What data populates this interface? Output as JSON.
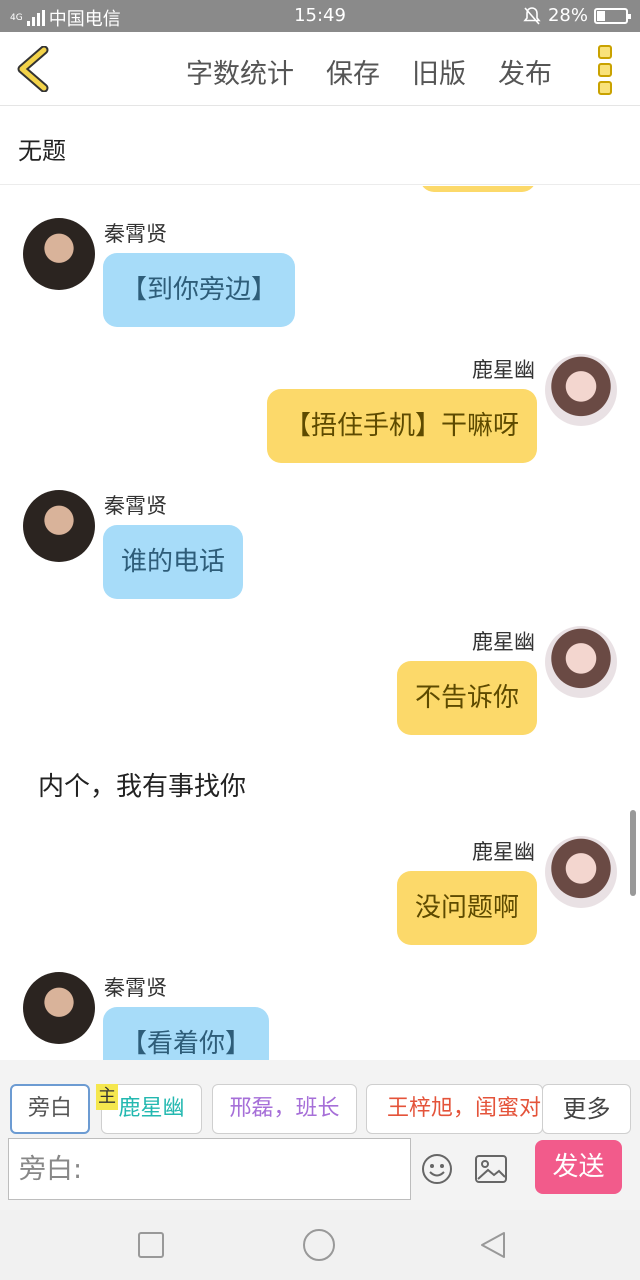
{
  "status": {
    "carrier": "中国电信",
    "network": "4G",
    "time": "15:49",
    "battery": "28%",
    "battery_level": 0.28
  },
  "toolbar": {
    "word_count": "字数统计",
    "save": "保存",
    "old_version": "旧版",
    "publish": "发布"
  },
  "story": {
    "title": "无题"
  },
  "messages": [
    {
      "name": "秦霄贤",
      "text": "【到你旁边】"
    },
    {
      "name": "鹿星幽",
      "text": "【捂住手机】干嘛呀"
    },
    {
      "name": "秦霄贤",
      "text": "谁的电话"
    },
    {
      "name": "鹿星幽",
      "text": "不告诉你"
    },
    {
      "narration": "内个，我有事找你"
    },
    {
      "name": "鹿星幽",
      "text": "没问题啊"
    },
    {
      "name": "秦霄贤",
      "text": "【看着你】"
    }
  ],
  "roles": {
    "narration": "旁白",
    "main_tag": "主",
    "main_role": "鹿星幽",
    "role2": "邢磊，班长",
    "role3": "王梓旭，闺蜜对象",
    "more": "更多"
  },
  "composer": {
    "placeholder": "旁白:",
    "send": "发送"
  },
  "colors": {
    "left_bubble": "#a7dcf9",
    "right_bubble": "#fcd96a",
    "send_button": "#f25b8b"
  }
}
